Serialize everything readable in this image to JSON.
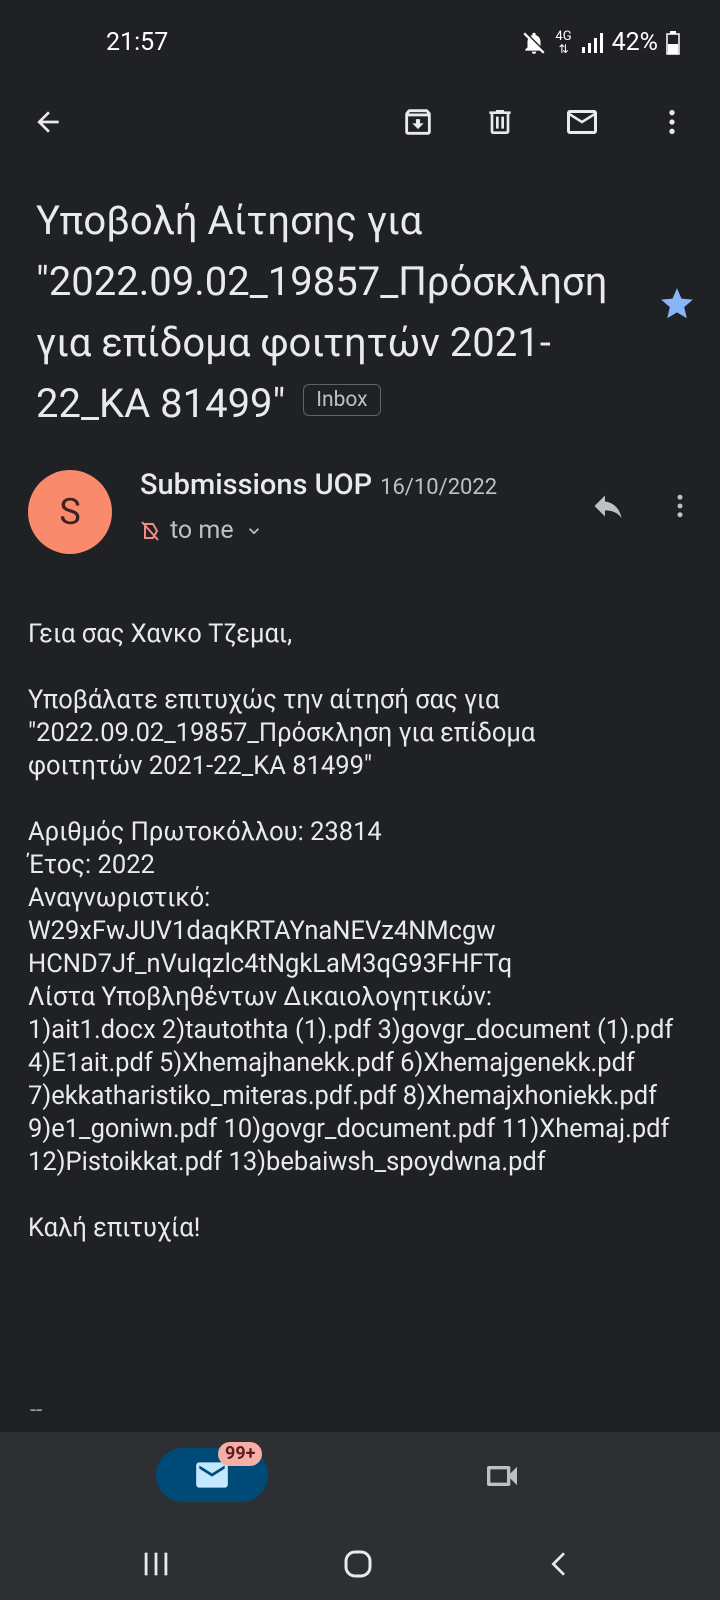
{
  "status": {
    "time": "21:57",
    "battery": "42%",
    "network": "4G"
  },
  "toolbar": {
    "back": "arrow-back-icon",
    "archive": "archive-icon",
    "delete": "trash-icon",
    "mark_unread": "mail-icon",
    "more": "more-vert-icon"
  },
  "email": {
    "subject": "Υποβολή Αίτησης για \"2022.09.02_19857_Πρόσκληση για επίδομα φοιτητών 2021-22_ΚΑ 81499\"",
    "label": "Inbox",
    "starred": true,
    "sender": {
      "initial": "S",
      "name": "Submissions UOP",
      "date": "16/10/2022",
      "to": "to me"
    },
    "greeting": "Γεια σας Χανκο Τζεμαι,",
    "intro": "Υποβάλατε επιτυχώς την αίτησή σας για \"2022.09.02_19857_Πρόσκληση για επίδομα φοιτητών 2021-22_ΚΑ 81499\"",
    "protocol": "Αριθμός Πρωτοκόλλου: 23814",
    "year": "Έτος: 2022",
    "identifier_label": "Αναγνωριστικό:",
    "identifier_line1": "W29xFwJUV1daqKRTAYnaNEVz4NMcgw",
    "identifier_line2": "HCND7Jf_nVuIqzlc4tNgkLaM3qG93FHFTq",
    "docs_label": "Λίστα Υποβληθέντων Δικαιολογητικών:",
    "docs_list": "1)ait1.docx 2)tautothta (1).pdf 3)govgr_document (1).pdf 4)E1ait.pdf 5)Xhemajhanekk.pdf 6)Xhemajgenekk.pdf 7)ekkatharistiko_miteras.pdf.pdf 8)Xhemajxhoniekk.pdf 9)e1_goniwn.pdf 10)govgr_document.pdf 11)Xhemaj.pdf 12)Pistoikkat.pdf 13)bebaiwsh_spoydwna.pdf",
    "closing": "Καλή επιτυχία!",
    "signature": "--"
  },
  "bottom_nav": {
    "mail_badge": "99+"
  },
  "colors": {
    "background": "#202124",
    "avatar": "#f98a6b",
    "star": "#8ab4f8",
    "nav_active": "#004a77",
    "badge": "#f6aea9"
  }
}
